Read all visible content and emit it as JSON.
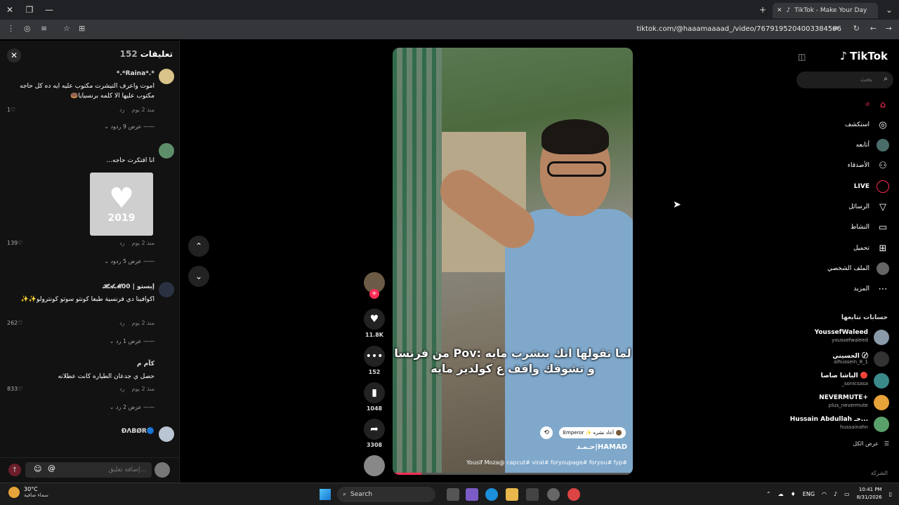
{
  "browser": {
    "tab_title": "TikTok - Make Your Day",
    "url": "tiktok.com/@haaamaaaad_/video/7679195204003384596"
  },
  "comments": {
    "title": "تعليقات",
    "count": "152",
    "items": [
      {
        "name": "*.*Raina*.*",
        "text": "اموت واعرف التيشرت مكتوب عليه ايه ده كل حاجه مكتوب عليها الا كلمه برنسيايا🍩",
        "time": "منذ 2 يوم",
        "reply": "رد",
        "likes": "1",
        "replies": "عرض 9 ردود"
      },
      {
        "name": "",
        "text": "انا افتكرت حاجه...",
        "time": "منذ 2 يوم",
        "reply": "رد",
        "likes": "139",
        "replies": "عرض 5 ردود",
        "sticker_year": "2019"
      },
      {
        "name": "إيستو | 𝓗𝓐𝓜00",
        "text": "اكوافينا دي فرنسية طبعا كونتو سوتو كونترولو✨✨",
        "time": "منذ 2 يوم",
        "reply": "رد",
        "likes": "262",
        "replies": "عرض 1 رد"
      },
      {
        "name": "كآم م",
        "text": "حصل ي جدعان الطياره كانت عطلانه",
        "time": "منذ 2 يوم",
        "reply": "رد",
        "likes": "833",
        "replies": "عرض 2 رد"
      },
      {
        "name": "🔵ĐΛBØR",
        "text": "",
        "time": "",
        "reply": "",
        "likes": "",
        "replies": ""
      }
    ],
    "input_placeholder": "إضافة تعليق..."
  },
  "video": {
    "caption": "لما تقولها انك بتشرب مايه :Pov من فرنسا و تشوفك واقف ع كولدير مايه",
    "repost_label": "Emperor ✨ أعاد نشره",
    "author": "HAMAD|حـمـد",
    "hashtags": "Yousif Moza@ capcut# viral# foryoupage# foryou# fyp#",
    "progress": 0.12,
    "likes": "11.8K",
    "comments": "152",
    "saves": "1048",
    "shares": "3308"
  },
  "sidebar": {
    "logo": "TikTok",
    "search_placeholder": "بحث",
    "nav": [
      {
        "label": "",
        "icon": "home-icon",
        "active": true
      },
      {
        "label": "استكشف",
        "icon": "compass-icon"
      },
      {
        "label": "أتابعه",
        "icon": "following-icon"
      },
      {
        "label": "الأصدقاء",
        "icon": "friends-icon"
      },
      {
        "label": "LIVE",
        "icon": "live-icon"
      },
      {
        "label": "الرسائل",
        "icon": "messages-icon"
      },
      {
        "label": "النشاط",
        "icon": "activity-icon"
      },
      {
        "label": "تحميل",
        "icon": "upload-icon"
      },
      {
        "label": "الملف الشخصي",
        "icon": "profile-icon"
      },
      {
        "label": "المزيد",
        "icon": "more-icon"
      }
    ],
    "following_title": "حسابات تتابعها",
    "accounts": [
      {
        "name": "YoussefWaleed",
        "handle": "youssefwaleed"
      },
      {
        "name": "الحسيني 〄",
        "handle": "alhussein_8_1"
      },
      {
        "name": "الباشا صاصا 🔴",
        "handle": "_sonicsasa"
      },
      {
        "name": "NEVERMUTE+",
        "handle": "plus_nevermute"
      },
      {
        "name": "Hussain Abdullah حـ...",
        "handle": "hussainahn"
      }
    ],
    "show_all": "عرض الكل",
    "company": "الشركة"
  },
  "taskbar": {
    "temp": "30°C",
    "weather": "سماء صافية",
    "search": "Search",
    "lang": "ENG",
    "time": "10:41 PM",
    "date": "8/31/2026"
  },
  "colors": {
    "brand": "#fe2c55",
    "background": "#000000",
    "panel": "#121212"
  }
}
